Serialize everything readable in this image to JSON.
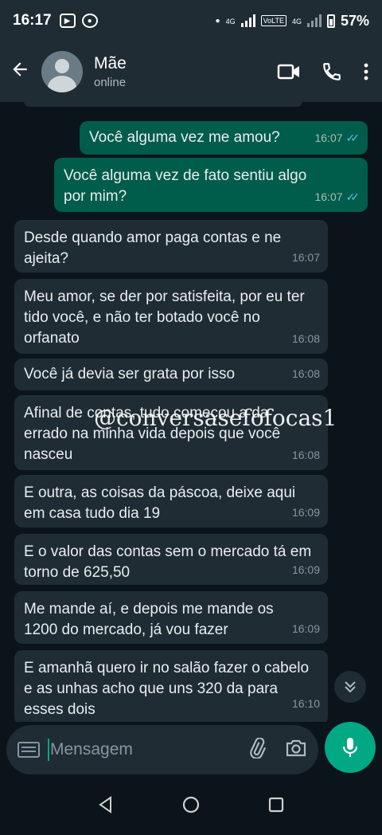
{
  "status_bar": {
    "time": "16:17",
    "net1": "4G",
    "volte": "VoLTE",
    "net2": "4G",
    "battery": "57%"
  },
  "header": {
    "name": "Mãe",
    "status": "online"
  },
  "messages": [
    {
      "dir": "out",
      "text": "Você alguma vez me amou?",
      "time": "16:07",
      "read": true
    },
    {
      "dir": "out",
      "text": "Você alguma vez de fato sentiu algo por mim?",
      "time": "16:07",
      "read": true
    },
    {
      "dir": "in",
      "text": "Desde quando amor paga contas e ne ajeita?",
      "time": "16:07"
    },
    {
      "dir": "in",
      "text": "Meu amor, se der por satisfeita, por eu ter tido você, e não ter botado você no orfanato",
      "time": "16:08"
    },
    {
      "dir": "in",
      "text": "Você já devia ser grata por isso",
      "time": "16:08"
    },
    {
      "dir": "in",
      "text": "Afinal de contas, tudo começou a da errado na minha vida depois que você nasceu",
      "time": "16:08"
    },
    {
      "dir": "in",
      "text": "E outra, as coisas da páscoa, deixe aqui em casa tudo dia 19",
      "time": "16:09"
    },
    {
      "dir": "in",
      "text": "E o valor das contas sem o mercado tá em torno de 625,50",
      "time": "16:09"
    },
    {
      "dir": "in",
      "text": "Me mande aí, e depois me mande os 1200 do mercado, já vou fazer",
      "time": "16:09"
    },
    {
      "dir": "in",
      "text": "E amanhã quero ir no salão fazer o cabelo e as unhas acho que uns 320 da para esses dois",
      "time": "16:10"
    }
  ],
  "watermark": "@conversasefofocas1",
  "input": {
    "placeholder": "Mensagem"
  },
  "icons": {
    "back": "arrow-left-icon",
    "video": "video-call-icon",
    "call": "phone-icon",
    "menu": "more-vert-icon",
    "keyboard": "keyboard-icon",
    "attach": "paperclip-icon",
    "camera": "camera-icon",
    "mic": "mic-icon",
    "scroll": "double-chevron-down-icon"
  },
  "colors": {
    "outgoing": "#005c4b",
    "incoming": "#1f2c34",
    "accent": "#00a884",
    "read_ticks": "#53bdeb"
  }
}
